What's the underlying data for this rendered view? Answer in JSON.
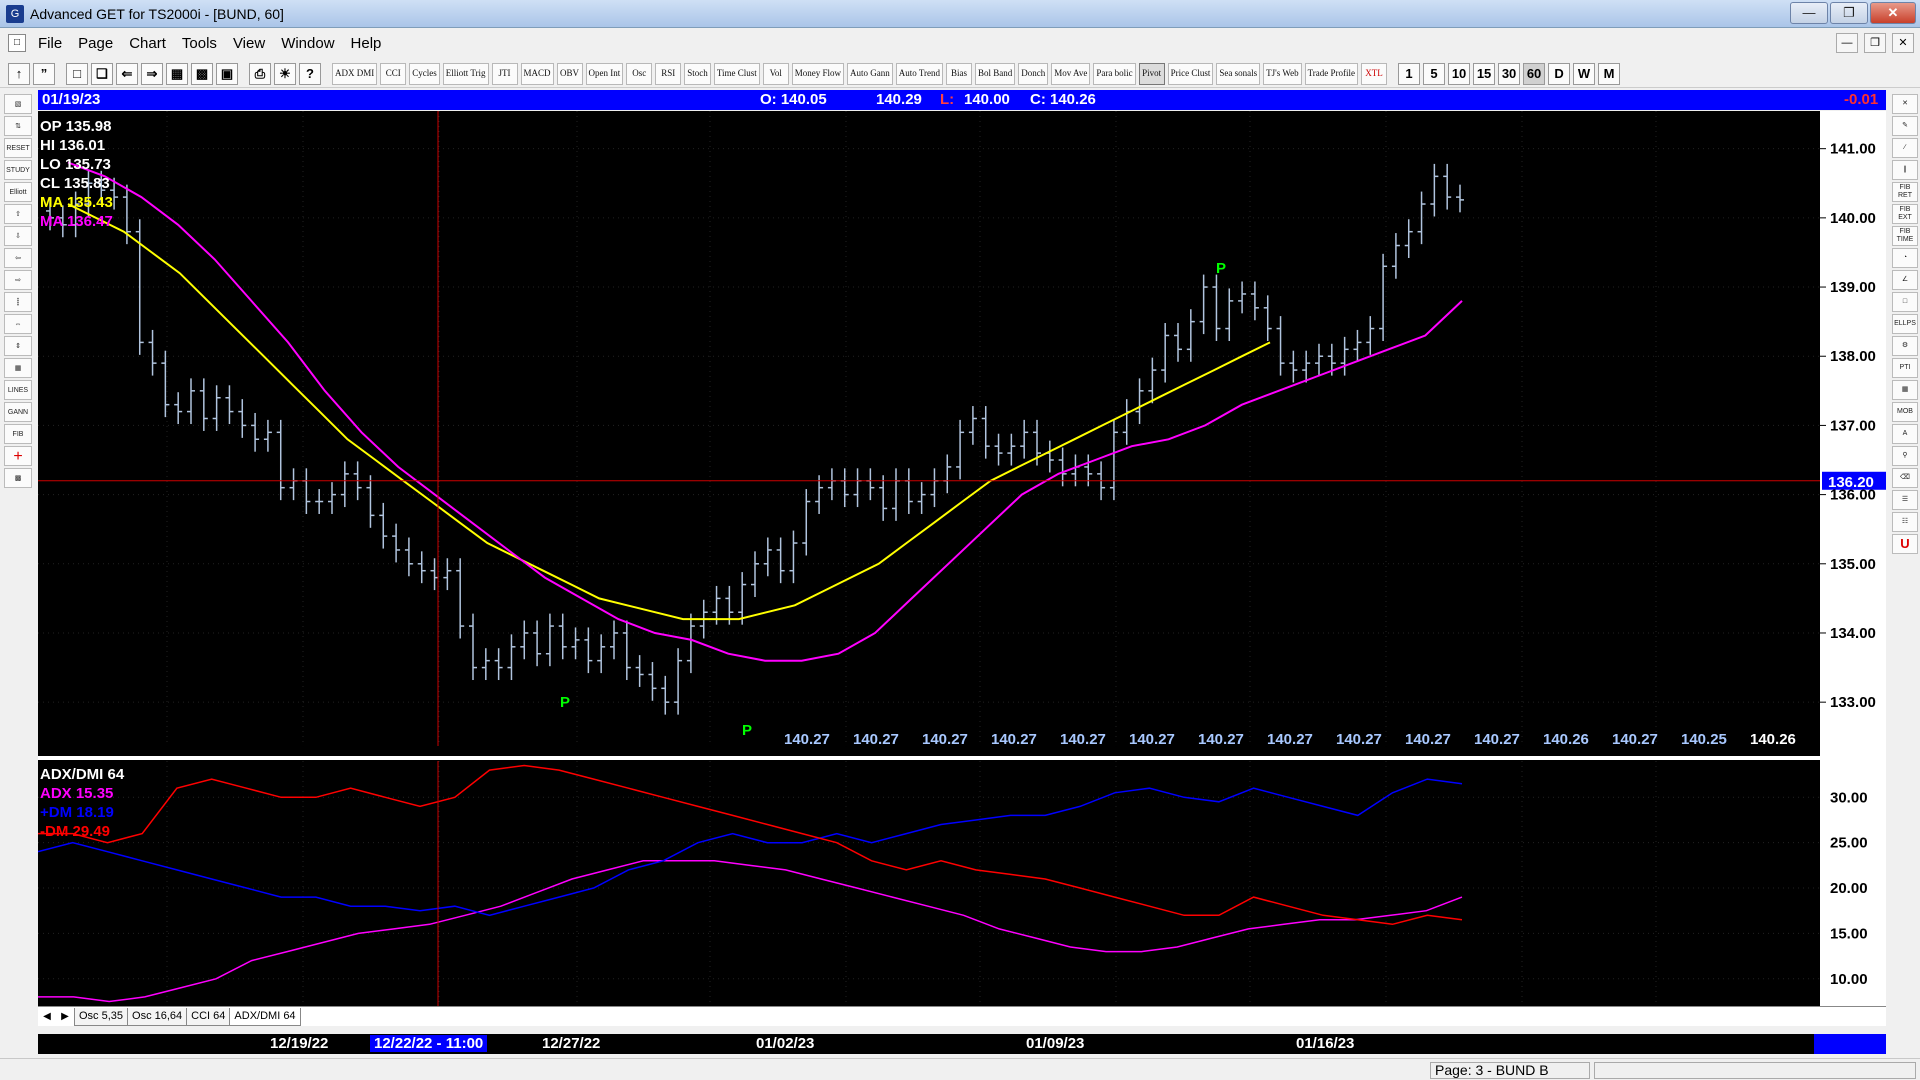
{
  "window": {
    "title": "Advanced GET for TS2000i - [BUND, 60]"
  },
  "menu": [
    "File",
    "Page",
    "Chart",
    "Tools",
    "View",
    "Window",
    "Help"
  ],
  "toolbar": {
    "studies": [
      "ADX DMI",
      "CCI",
      "Cycles",
      "Elliott Trig",
      "JTI",
      "MACD",
      "OBV",
      "Open Int",
      "Osc",
      "RSI",
      "Stoch",
      "Time Clust",
      "Vol",
      "Money Flow",
      "Auto Gann",
      "Auto Trend",
      "Bias",
      "Bol Band",
      "Donch",
      "Mov Ave",
      "Para bolic",
      "Pivot",
      "Price Clust",
      "Sea sonals",
      "TJ's Web",
      "Trade Profile",
      "XTL"
    ],
    "intervals": [
      "1",
      "5",
      "10",
      "15",
      "30",
      "60",
      "D",
      "W",
      "M"
    ],
    "selected_interval": "60"
  },
  "left_toolbar": [
    "RESET",
    "STUDY",
    "Elliott",
    "LINES",
    "GANN",
    "FIB"
  ],
  "right_toolbar": [
    "FIB RET",
    "FIB EXT",
    "FIB TIME",
    "ELLPS",
    "PTI",
    "MOB",
    "U"
  ],
  "header": {
    "date": "01/19/23",
    "open": "O: 140.05",
    "high": "140.29",
    "low_label": "L:",
    "low": "140.00",
    "close": "C: 140.26",
    "change": "-0.01"
  },
  "price_panel": {
    "legend": {
      "op": "OP  135.98",
      "hi": "HI   136.01",
      "lo": "LO  135.73",
      "cl": "CL  135.83",
      "ma1": "MA  135.43",
      "ma2": "MA  136.47"
    },
    "y_ticks": [
      "141.00",
      "140.00",
      "139.00",
      "138.00",
      "137.00",
      "136.00",
      "135.00",
      "134.00",
      "133.00"
    ],
    "cursor_price": "136.20",
    "bottom_values": [
      "140.27",
      "140.27",
      "140.27",
      "140.27",
      "140.27",
      "140.27",
      "140.27",
      "140.27",
      "140.27",
      "140.27",
      "140.27",
      "140.26",
      "140.27",
      "140.25",
      "140.26"
    ],
    "pivot_label": "P"
  },
  "adx_panel": {
    "title": "ADX/DMI 64",
    "adx": "ADX 15.35",
    "pdm": "+DM 18.19",
    "mdm": "-DM  29.49",
    "y_ticks": [
      "30.00",
      "25.00",
      "20.00",
      "15.00",
      "10.00"
    ]
  },
  "tabs": [
    "Osc 5,35",
    "Osc 16,64",
    "CCI 64",
    "ADX/DMI 64"
  ],
  "dates": {
    "d1": "12/19/22",
    "cursor": "12/22/22 - 11:00",
    "d2": "12/27/22",
    "d3": "01/02/23",
    "d4": "01/09/23",
    "d5": "01/16/23"
  },
  "status": {
    "page": "Page: 3 - BUND B"
  },
  "colors": {
    "candle": "#b0c4de",
    "ma_fast": "#ffff00",
    "ma_slow": "#ff00ff",
    "adx": "#ff00ff",
    "pdm": "#0000ff",
    "mdm": "#ff0000",
    "pivot": "#00ff00",
    "cursor": "#cc0000"
  },
  "chart_data": {
    "type": "candlestick",
    "price_ylim": [
      132.8,
      141.4
    ],
    "closes": [
      140.0,
      139.9,
      140.2,
      140.5,
      140.4,
      140.3,
      139.8,
      138.2,
      137.9,
      137.3,
      137.2,
      137.5,
      137.1,
      137.4,
      137.2,
      137.0,
      136.8,
      136.9,
      136.1,
      136.2,
      135.9,
      135.9,
      136.0,
      136.3,
      136.1,
      135.7,
      135.4,
      135.2,
      135.0,
      134.9,
      134.8,
      134.9,
      134.1,
      133.5,
      133.6,
      133.5,
      133.8,
      134.0,
      133.7,
      134.1,
      133.8,
      133.9,
      133.6,
      133.8,
      134.0,
      133.5,
      133.4,
      133.2,
      133.0,
      133.6,
      134.1,
      134.3,
      134.5,
      134.3,
      134.7,
      135.0,
      135.2,
      134.9,
      135.3,
      135.9,
      136.1,
      136.2,
      136.0,
      136.2,
      136.1,
      135.8,
      136.2,
      135.9,
      136.0,
      136.2,
      136.4,
      136.9,
      137.1,
      136.7,
      136.6,
      136.7,
      136.9,
      136.6,
      136.5,
      136.3,
      136.4,
      136.3,
      136.1,
      136.9,
      137.2,
      137.5,
      137.8,
      138.3,
      138.1,
      138.5,
      139.0,
      138.4,
      138.8,
      138.9,
      138.7,
      138.4,
      137.9,
      137.8,
      137.9,
      138.0,
      137.9,
      138.1,
      138.2,
      138.4,
      139.3,
      139.6,
      139.8,
      140.2,
      140.6,
      140.3,
      140.26
    ],
    "ma_fast": [
      140.2,
      140.0,
      139.8,
      139.5,
      139.2,
      138.8,
      138.4,
      138.0,
      137.6,
      137.2,
      136.8,
      136.5,
      136.2,
      135.9,
      135.6,
      135.3,
      135.1,
      134.9,
      134.7,
      134.5,
      134.4,
      134.3,
      134.2,
      134.2,
      134.2,
      134.3,
      134.4,
      134.6,
      134.8,
      135.0,
      135.3,
      135.6,
      135.9,
      136.2,
      136.4,
      136.6,
      136.8,
      137.0,
      137.2,
      137.4,
      137.6,
      137.8,
      138.0,
      138.2
    ],
    "ma_slow": [
      140.8,
      140.6,
      140.3,
      139.9,
      139.4,
      138.8,
      138.2,
      137.5,
      136.9,
      136.4,
      136.0,
      135.6,
      135.2,
      134.8,
      134.5,
      134.2,
      134.0,
      133.9,
      133.7,
      133.6,
      133.6,
      133.7,
      134.0,
      134.5,
      135.0,
      135.5,
      136.0,
      136.3,
      136.5,
      136.7,
      136.8,
      137.0,
      137.3,
      137.5,
      137.7,
      137.9,
      138.1,
      138.3,
      138.8
    ],
    "adx_ylim": [
      7,
      34
    ],
    "adx": [
      8,
      8,
      7.5,
      8,
      9,
      10,
      12,
      13,
      14,
      15,
      15.5,
      16,
      17,
      18,
      19.5,
      21,
      22,
      23,
      23,
      23,
      22.5,
      22,
      21,
      20,
      19,
      18,
      17,
      15.5,
      14.5,
      13.5,
      13,
      13,
      13.5,
      14.5,
      15.5,
      16,
      16.5,
      16.5,
      17,
      17.5,
      19
    ],
    "plus_dm": [
      24,
      25,
      24,
      23,
      22,
      21,
      20,
      19,
      19,
      18,
      18,
      17.5,
      18,
      17,
      18,
      19,
      20,
      22,
      23,
      25,
      26,
      25,
      25,
      26,
      25,
      26,
      27,
      27.5,
      28,
      28,
      29,
      30.5,
      31,
      30,
      29.5,
      31,
      30,
      29,
      28,
      30.5,
      32,
      31.5
    ],
    "minus_dm": [
      26,
      26,
      25,
      26,
      31,
      32,
      31,
      30,
      30,
      31,
      30,
      29,
      30,
      33,
      33.5,
      33,
      32,
      31,
      30,
      29,
      28,
      27,
      26,
      25,
      23,
      22,
      23,
      22,
      21.5,
      21,
      20,
      19,
      18,
      17,
      17,
      19,
      18,
      17,
      16.5,
      16,
      17,
      16.5
    ]
  }
}
